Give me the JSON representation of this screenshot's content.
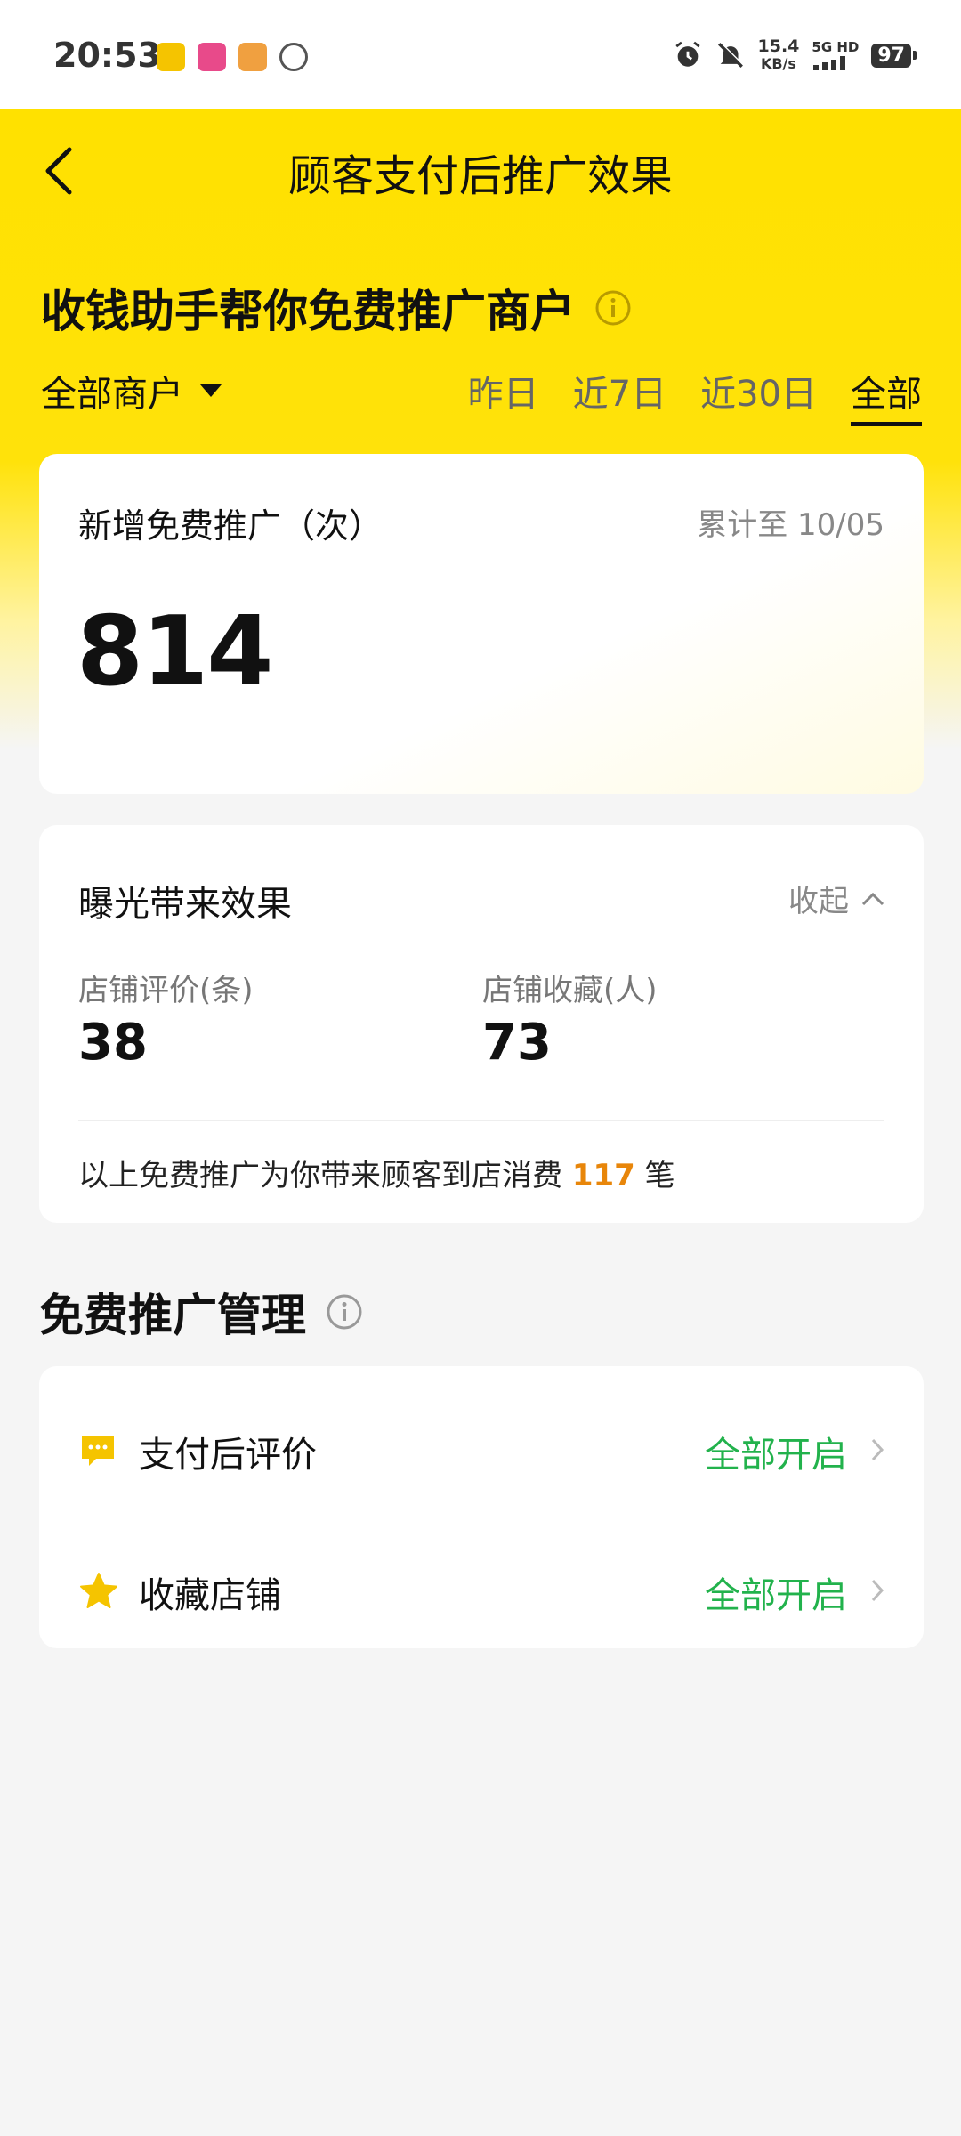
{
  "status_bar": {
    "time": "20:53",
    "speed_value": "15.4",
    "speed_unit": "KB/s",
    "network_label": "5G HD",
    "battery": "97"
  },
  "nav": {
    "title": "顾客支付后推广效果"
  },
  "headline": "收钱助手帮你免费推广商户",
  "merchant_filter": "全部商户",
  "range_tabs": [
    "昨日",
    "近7日",
    "近30日",
    "全部"
  ],
  "promo_card": {
    "label": "新增免费推广（次）",
    "date_label": "累计至 10/05",
    "value": "814"
  },
  "effect_card": {
    "title": "曝光带来效果",
    "collapse_label": "收起",
    "stats": [
      {
        "label": "店铺评价(条)",
        "value": "38"
      },
      {
        "label": "店铺收藏(人)",
        "value": "73"
      }
    ],
    "summary_prefix": "以上免费推广为你带来顾客到店消费",
    "summary_count": "117",
    "summary_suffix": "笔"
  },
  "manage": {
    "title": "免费推广管理",
    "rows": [
      {
        "label": "支付后评价",
        "status": "全部开启",
        "icon": "chat-bubble-icon"
      },
      {
        "label": "收藏店铺",
        "status": "全部开启",
        "icon": "star-icon"
      }
    ]
  },
  "colors": {
    "brand_yellow": "#ffe100",
    "accent_orange": "#e8860a",
    "status_green": "#22b24c"
  }
}
